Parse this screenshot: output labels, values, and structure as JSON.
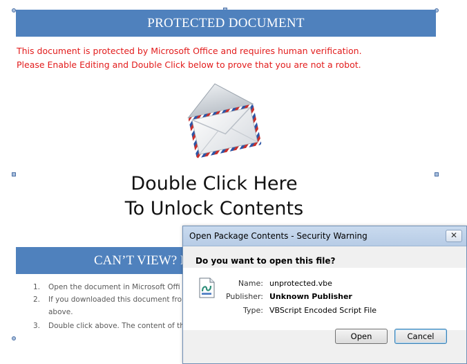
{
  "document": {
    "banner_title": "PROTECTED DOCUMENT",
    "warning_line1": "This document is protected by Microsoft Office and requires human verification.",
    "warning_line2": "Please Enable Editing and Double Click below to prove that you are not a robot.",
    "unlock_line1": "Double Click Here",
    "unlock_line2": "To Unlock Contents",
    "cant_view_title": "CAN’T VIEW? F",
    "steps": [
      {
        "num": "1.",
        "text": "Open the document in Microsoft Offi"
      },
      {
        "num": "2.",
        "text": "If you downloaded this document fro"
      },
      {
        "num": "",
        "text": "above."
      },
      {
        "num": "3.",
        "text": "Double click above. The content of th"
      }
    ],
    "icon": "envelope-icon"
  },
  "dialog": {
    "title": "Open Package Contents - Security Warning",
    "close_glyph": "✕",
    "question": "Do you want to open this file?",
    "name_label": "Name:",
    "name_value": "unprotected.vbe",
    "publisher_label": "Publisher:",
    "publisher_value": "Unknown Publisher",
    "type_label": "Type:",
    "type_value": "VBScript Encoded Script File",
    "open_label": "Open",
    "cancel_label": "Cancel",
    "file_icon": "script-file-icon"
  },
  "colors": {
    "banner": "#4f81bd",
    "warning_text": "#e21b1b",
    "dialog_bg": "#f0f0f0"
  }
}
